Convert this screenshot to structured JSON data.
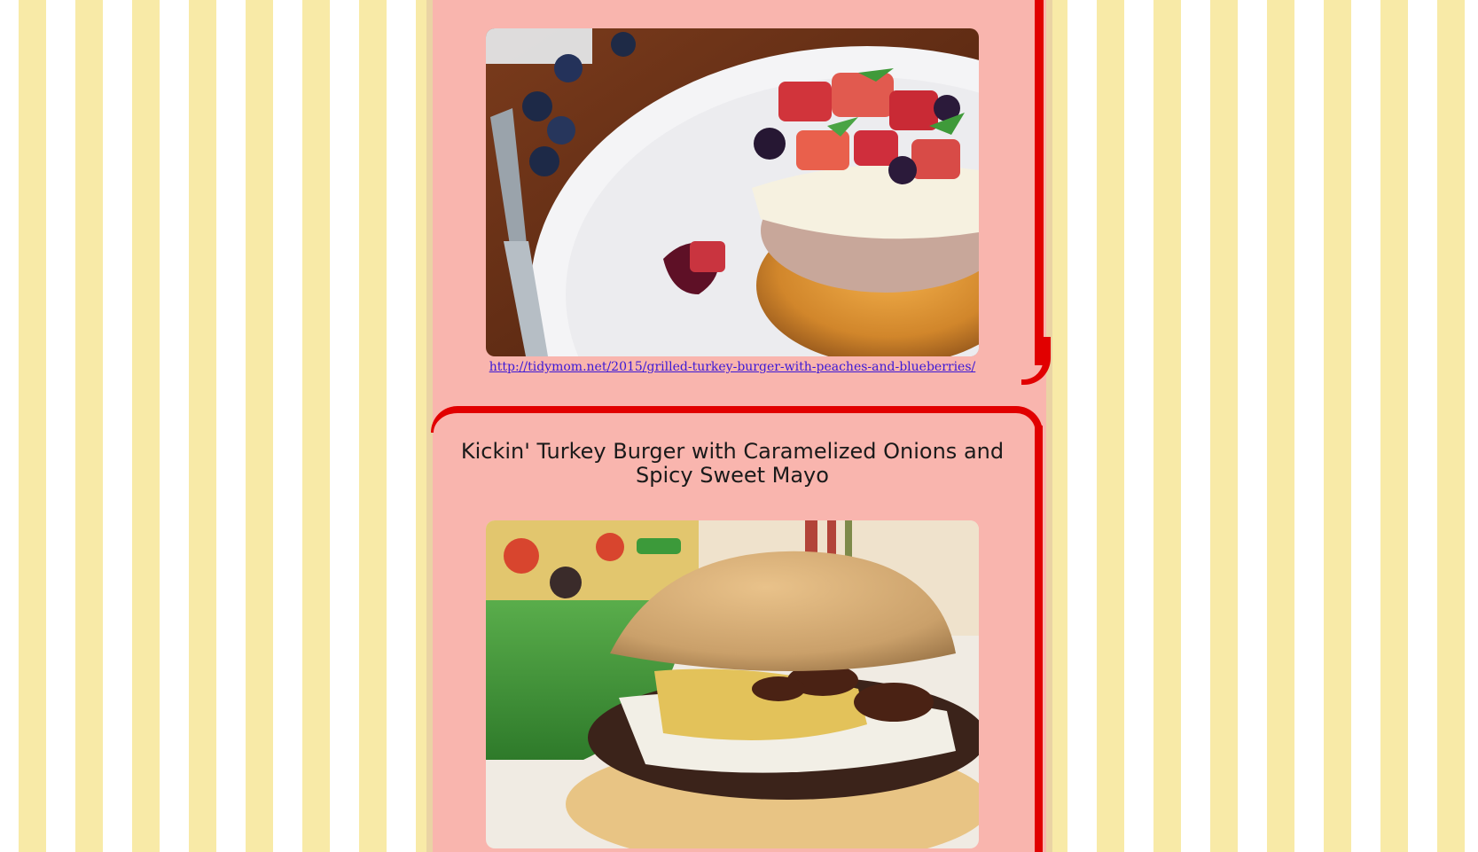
{
  "colors": {
    "stripe": "#f8eaa7",
    "column_background": "#f9b5ae",
    "card_border": "#e10000",
    "link": "#3b18d6",
    "title_text": "#1a1a1a"
  },
  "posts": [
    {
      "image_description_icon": "turkey-burger-peaches-blueberries-photo",
      "source_link": "http://tidymom.net/2015/grilled-turkey-burger-with-peaches-and-blueberries/"
    },
    {
      "title": "Kickin' Turkey Burger with Caramelized Onions and Spicy Sweet Mayo",
      "image_description_icon": "turkey-burger-caramelized-onions-photo"
    }
  ]
}
